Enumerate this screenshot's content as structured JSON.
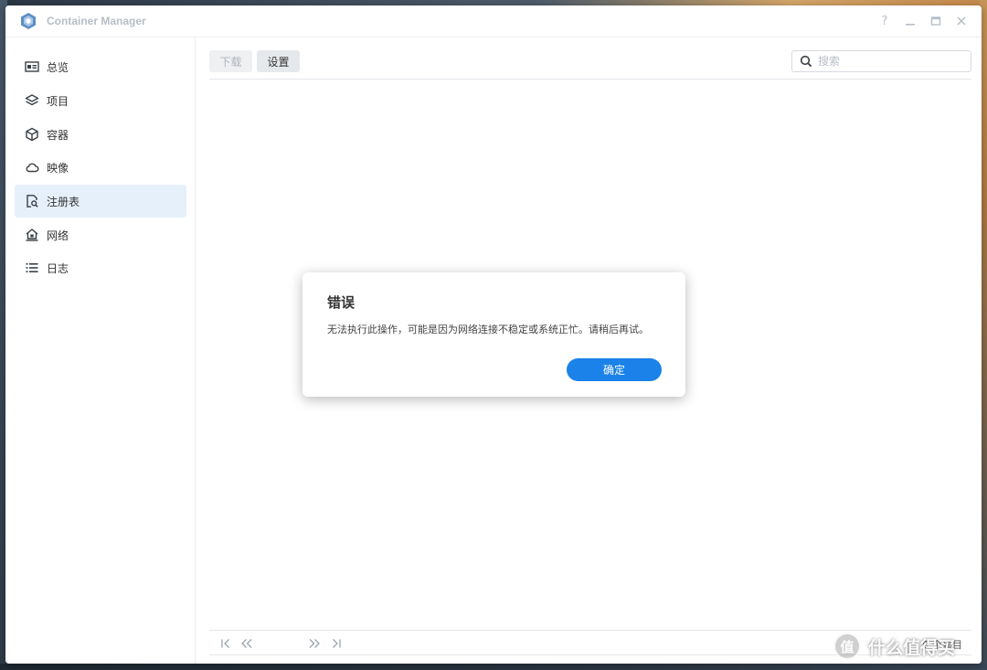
{
  "window": {
    "title": "Container Manager",
    "controls": {
      "help": "?",
      "minimize": "—",
      "maximize": "▭",
      "close": "✕"
    }
  },
  "sidebar": {
    "items": [
      {
        "label": "总览",
        "icon": "dashboard-icon",
        "active": false
      },
      {
        "label": "项目",
        "icon": "layers-icon",
        "active": false
      },
      {
        "label": "容器",
        "icon": "cube-icon",
        "active": false
      },
      {
        "label": "映像",
        "icon": "cloud-icon",
        "active": false
      },
      {
        "label": "注册表",
        "icon": "registry-search-icon",
        "active": true
      },
      {
        "label": "网络",
        "icon": "network-home-icon",
        "active": false
      },
      {
        "label": "日志",
        "icon": "list-icon",
        "active": false
      }
    ]
  },
  "toolbar": {
    "download_label": "下载",
    "settings_label": "设置",
    "search_placeholder": "搜索"
  },
  "pager": {
    "first": "|<",
    "prev": "«",
    "next": "»",
    "last": ">|",
    "count_text": "0 个项目"
  },
  "dialog": {
    "title": "错误",
    "message": "无法执行此操作，可能是因为网络连接不稳定或系统正忙。请稍后再试。",
    "ok_label": "确定"
  },
  "watermark": {
    "badge": "值",
    "text": "什么值得买"
  },
  "colors": {
    "accent": "#1a82e8",
    "active_nav_bg": "#e6f0fb"
  }
}
